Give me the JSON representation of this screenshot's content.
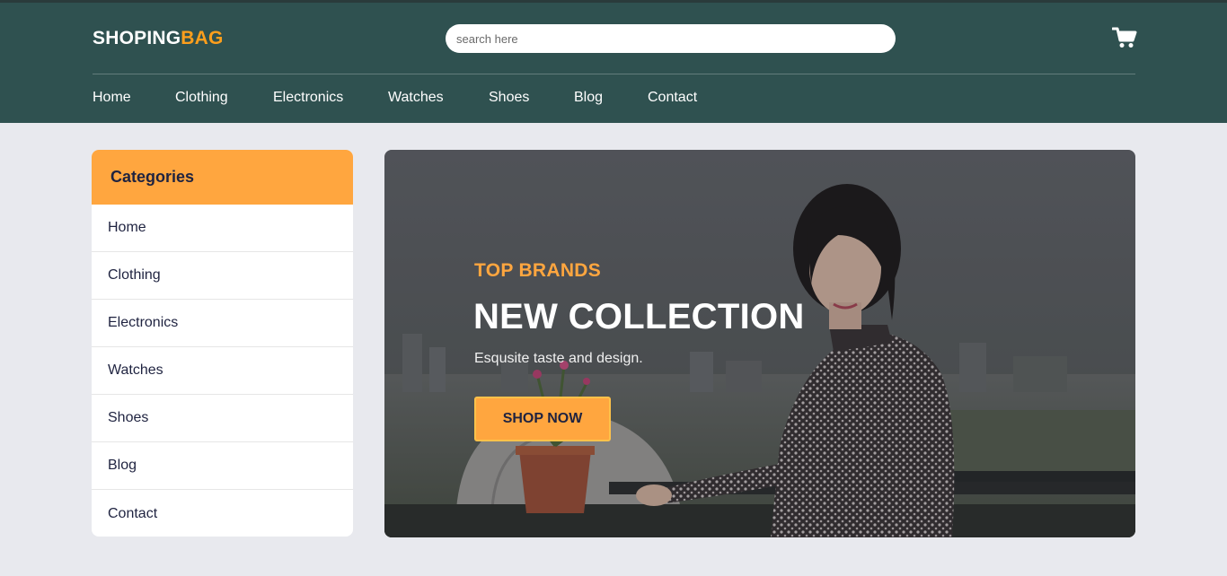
{
  "brand": {
    "part1": "SHOPING",
    "part2": "BAG",
    "accent_color": "#ff9f1c"
  },
  "search": {
    "placeholder": "search here",
    "value": ""
  },
  "header": {
    "background": "#2f5150",
    "cart_icon": "cart-icon"
  },
  "nav": {
    "items": [
      {
        "label": "Home"
      },
      {
        "label": "Clothing"
      },
      {
        "label": "Electronics"
      },
      {
        "label": "Watches"
      },
      {
        "label": "Shoes"
      },
      {
        "label": "Blog"
      },
      {
        "label": "Contact"
      }
    ]
  },
  "sidebar": {
    "title": "Categories",
    "header_color": "#ffa63f",
    "items": [
      {
        "label": "Home"
      },
      {
        "label": "Clothing"
      },
      {
        "label": "Electronics"
      },
      {
        "label": "Watches"
      },
      {
        "label": "Shoes"
      },
      {
        "label": "Blog"
      },
      {
        "label": "Contact"
      }
    ]
  },
  "hero": {
    "subtitle": "TOP BRANDS",
    "title": "NEW COLLECTION",
    "description": "Esqusite taste and design.",
    "button_label": "SHOP NOW",
    "button_color": "#ffa63f"
  }
}
